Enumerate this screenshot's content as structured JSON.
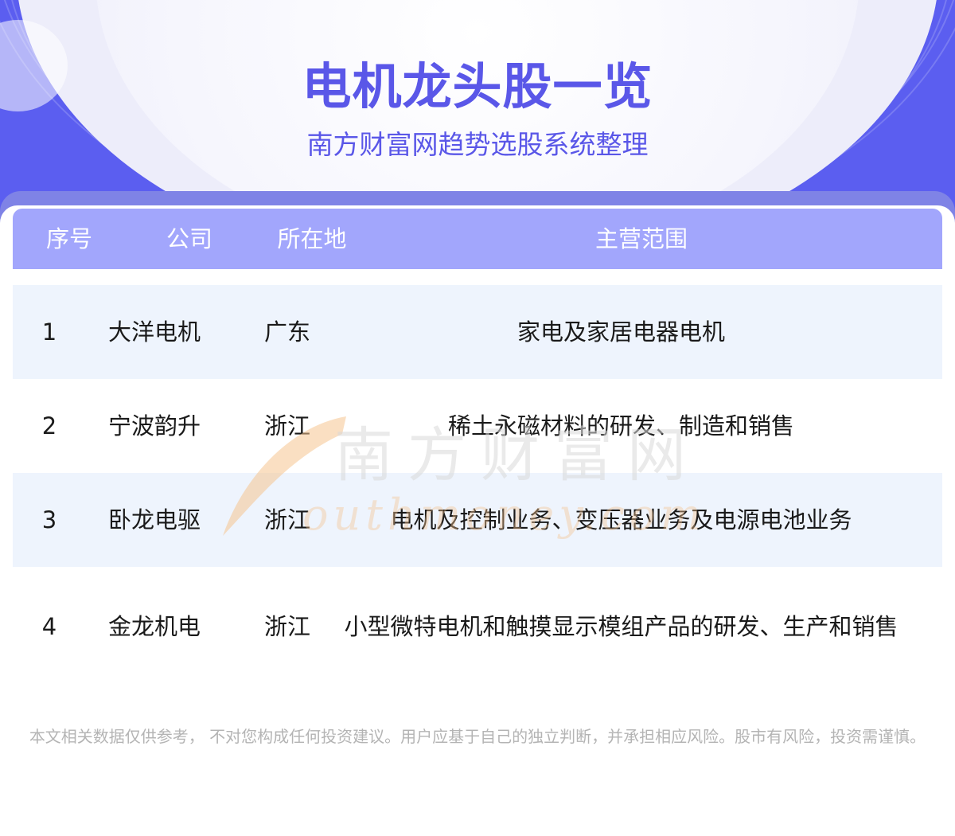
{
  "header": {
    "title": "电机龙头股一览",
    "subtitle": "南方财富网趋势选股系统整理"
  },
  "table": {
    "columns": [
      "序号",
      "公司",
      "所在地",
      "主营范围"
    ],
    "rows": [
      {
        "index": "1",
        "company": "大洋电机",
        "location": "广东",
        "business": "家电及家居电器电机"
      },
      {
        "index": "2",
        "company": "宁波韵升",
        "location": "浙江",
        "business": "稀土永磁材料的研发、制造和销售"
      },
      {
        "index": "3",
        "company": "卧龙电驱",
        "location": "浙江",
        "business": "电机及控制业务、变压器业务及电源电池业务"
      },
      {
        "index": "4",
        "company": "金龙机电",
        "location": "浙江",
        "business": "小型微特电机和触摸显示模组产品的研发、生产和销售"
      }
    ]
  },
  "watermark": {
    "cn": "南方财富网",
    "en": "outhmoney.com"
  },
  "disclaimer": "本文相关数据仅供参考， 不对您构成任何投资建议。用户应基于自己的独立判断，并承担相应风险。股市有风险，投资需谨慎。",
  "colors": {
    "brand_blue": "#5b5ef0",
    "title_text": "#5a57e8",
    "header_row": "#a2a6fc",
    "alt_row": "#eef4fd",
    "watermark_orange": "#f5c490"
  }
}
